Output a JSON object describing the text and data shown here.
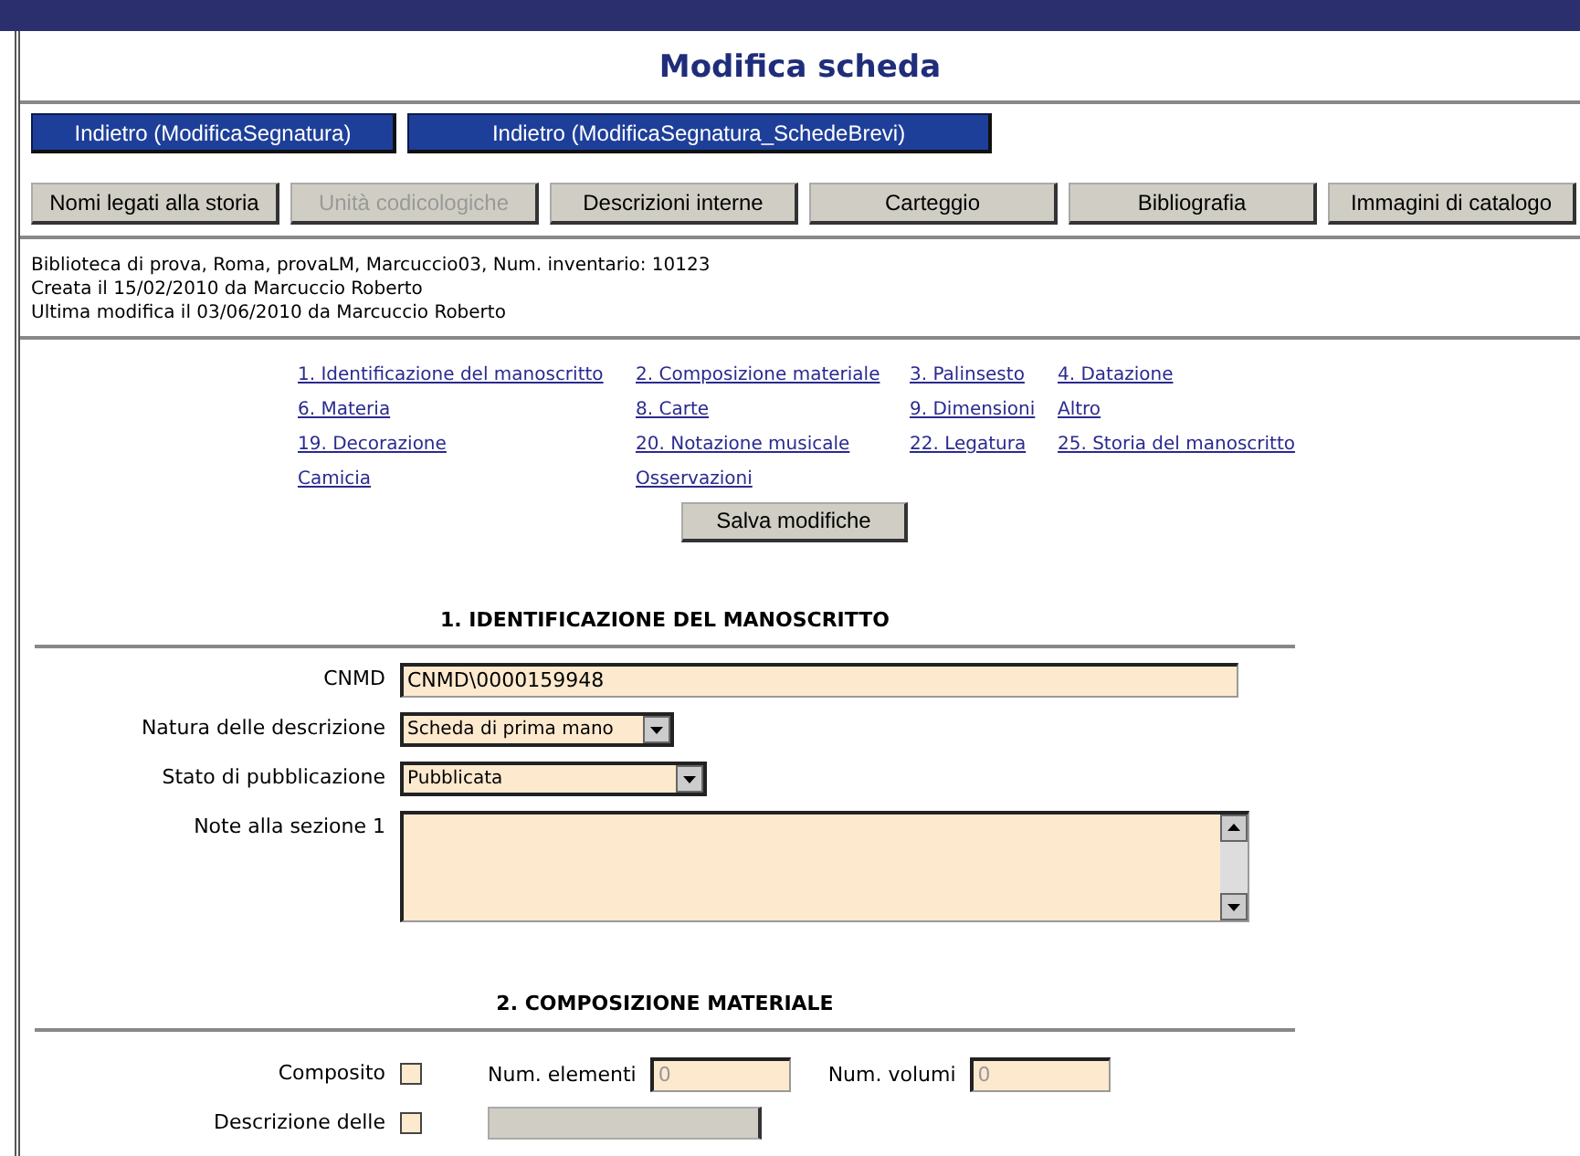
{
  "title": "Modifica scheda",
  "back_buttons": [
    "Indietro (ModificaSegnatura)",
    "Indietro (ModificaSegnatura_SchedeBrevi)"
  ],
  "tabs": [
    {
      "label": "Nomi legati alla storia",
      "disabled": false
    },
    {
      "label": "Unità codicologiche",
      "disabled": true
    },
    {
      "label": "Descrizioni interne",
      "disabled": false
    },
    {
      "label": "Carteggio",
      "disabled": false
    },
    {
      "label": "Bibliografia",
      "disabled": false
    },
    {
      "label": "Immagini di catalogo",
      "disabled": false
    }
  ],
  "info_lines": [
    "Biblioteca di prova, Roma, provaLM, Marcuccio03, Num. inventario: 10123",
    "Creata il 15/02/2010 da Marcuccio Roberto",
    "Ultima modifica il 03/06/2010 da Marcuccio Roberto"
  ],
  "section_links": [
    [
      "1. Identificazione del manoscritto",
      "2. Composizione materiale",
      "3. Palinsesto",
      "4. Datazione"
    ],
    [
      "6. Materia",
      "8. Carte",
      "9. Dimensioni",
      "Altro"
    ],
    [
      "19. Decorazione",
      "20. Notazione musicale",
      "22. Legatura",
      "25. Storia del manoscritto"
    ],
    [
      "Camicia",
      "Osservazioni"
    ]
  ],
  "save_button": "Salva modifiche",
  "section_1": {
    "heading": "1. IDENTIFICAZIONE DEL MANOSCRITTO",
    "fields": [
      {
        "kind": "text",
        "label": "CNMD",
        "value": "CNMD\\0000159948"
      },
      {
        "kind": "select",
        "label": "Natura delle descrizione",
        "value": "Scheda di prima mano"
      },
      {
        "kind": "select",
        "label": "Stato di pubblicazione",
        "value": "Pubblicata"
      },
      {
        "kind": "textarea",
        "label": "Note alla sezione 1"
      }
    ]
  },
  "section_2": {
    "heading": "2. COMPOSIZIONE MATERIALE",
    "composito": {
      "label": "Composito",
      "checked": false,
      "elementi_label": "Num. elementi",
      "elementi_value": "0",
      "volumi_label": "Num. volumi",
      "volumi_value": "0"
    },
    "descrizione": {
      "label": "Descrizione delle",
      "checked": false
    }
  }
}
